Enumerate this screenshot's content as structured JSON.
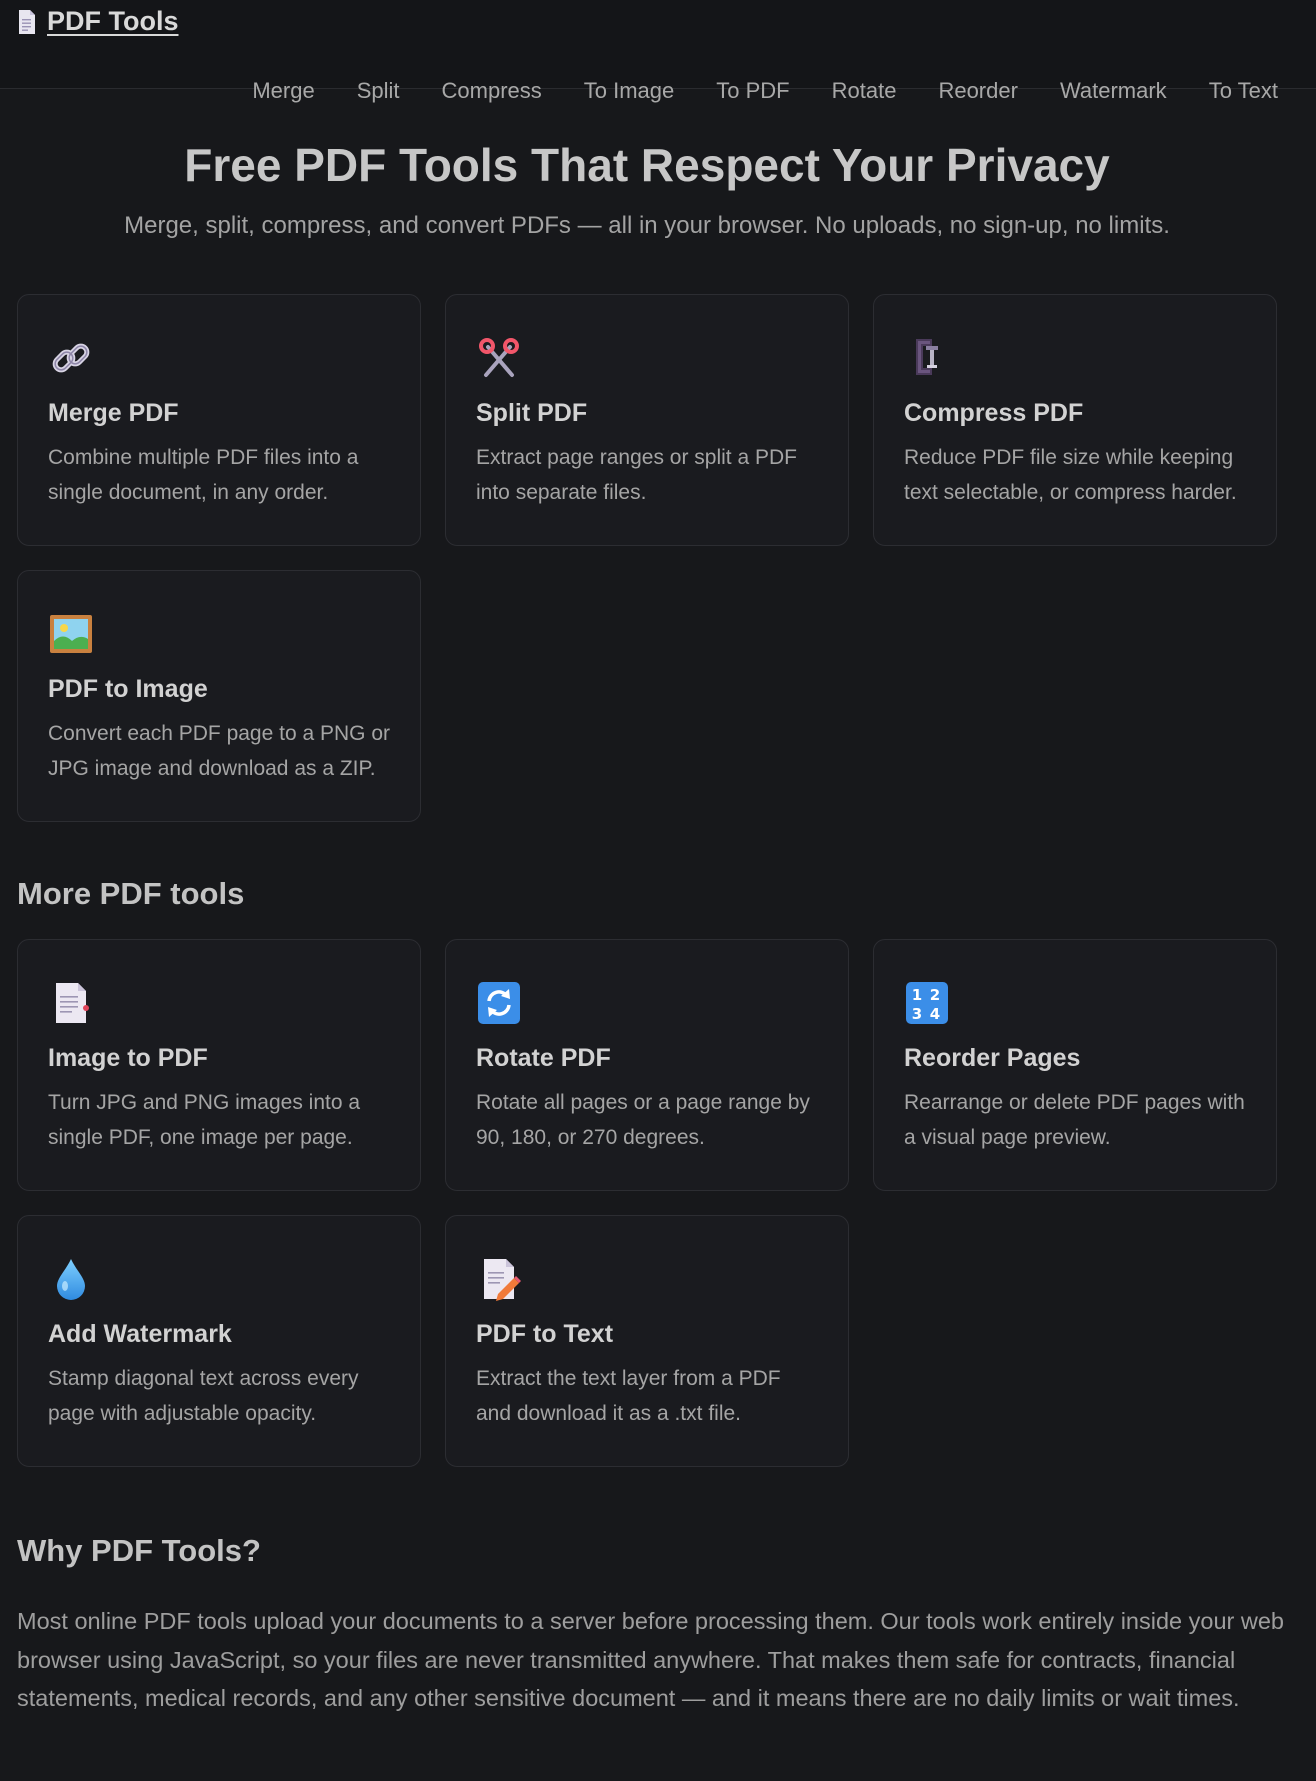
{
  "header": {
    "brand": "PDF Tools",
    "nav": [
      "Merge",
      "Split",
      "Compress",
      "To Image",
      "To PDF",
      "Rotate",
      "Reorder",
      "Watermark",
      "To Text"
    ]
  },
  "hero": {
    "title": "Free PDF Tools That Respect Your Privacy",
    "subtitle": "Merge, split, compress, and convert PDFs — all in your browser. No uploads, no sign-up, no limits."
  },
  "primary_tools": [
    {
      "icon": "link-icon",
      "title": "Merge PDF",
      "desc": "Combine multiple PDF files into a single document, in any order."
    },
    {
      "icon": "scissors-icon",
      "title": "Split PDF",
      "desc": "Extract page ranges or split a PDF into separate files."
    },
    {
      "icon": "clamp-icon",
      "title": "Compress PDF",
      "desc": "Reduce PDF file size while keeping text selectable, or compress harder."
    },
    {
      "icon": "picture-icon",
      "title": "PDF to Image",
      "desc": "Convert each PDF page to a PNG or JPG image and download as a ZIP."
    }
  ],
  "more_section_title": "More PDF tools",
  "more_tools": [
    {
      "icon": "page-icon",
      "title": "Image to PDF",
      "desc": "Turn JPG and PNG images into a single PDF, one image per page."
    },
    {
      "icon": "rotate-icon",
      "title": "Rotate PDF",
      "desc": "Rotate all pages or a page range by 90, 180, or 270 degrees."
    },
    {
      "icon": "numbers-icon",
      "title": "Reorder Pages",
      "desc": "Rearrange or delete PDF pages with a visual page preview."
    },
    {
      "icon": "droplet-icon",
      "title": "Add Watermark",
      "desc": "Stamp diagonal text across every page with adjustable opacity."
    },
    {
      "icon": "memo-icon",
      "title": "PDF to Text",
      "desc": "Extract the text layer from a PDF and download it as a .txt file."
    }
  ],
  "why": {
    "title": "Why PDF Tools?",
    "text": "Most online PDF tools upload your documents to a server before processing them. Our tools work entirely inside your web browser using JavaScript, so your files are never transmitted anywhere. That makes them safe for contracts, financial statements, medical records, and any other sensitive document — and it means there are no daily limits or wait times."
  },
  "colors": {
    "background": "#17181b",
    "card": "#1a1b1f",
    "card_border": "#2c2d32"
  }
}
